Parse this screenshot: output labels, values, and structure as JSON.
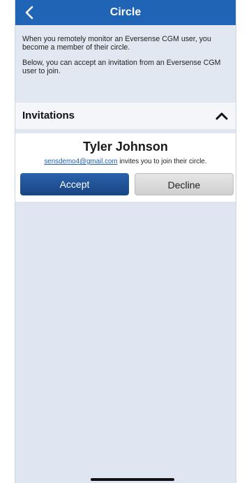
{
  "nav": {
    "title": "Circle",
    "back_icon": "chevron-left-icon"
  },
  "intro": {
    "paragraph1": "When you remotely monitor an Eversense CGM user, you become a member of their circle.",
    "paragraph2": "Below, you can accept an invitation from an Eversense CGM user to join."
  },
  "invitations": {
    "title": "Invitations",
    "collapse_icon": "chevron-up-icon",
    "items": [
      {
        "name": "Tyler Johnson",
        "email": "sensdemo4@gmail.com",
        "message": " invites you to join their circle.",
        "accept_label": "Accept",
        "decline_label": "Decline"
      }
    ]
  },
  "colors": {
    "nav_bar": "#1f64b5",
    "background": "#e0e6f1",
    "accept": "#1b4f93",
    "decline": "#d9d9d9",
    "link": "#1f5fb0"
  }
}
